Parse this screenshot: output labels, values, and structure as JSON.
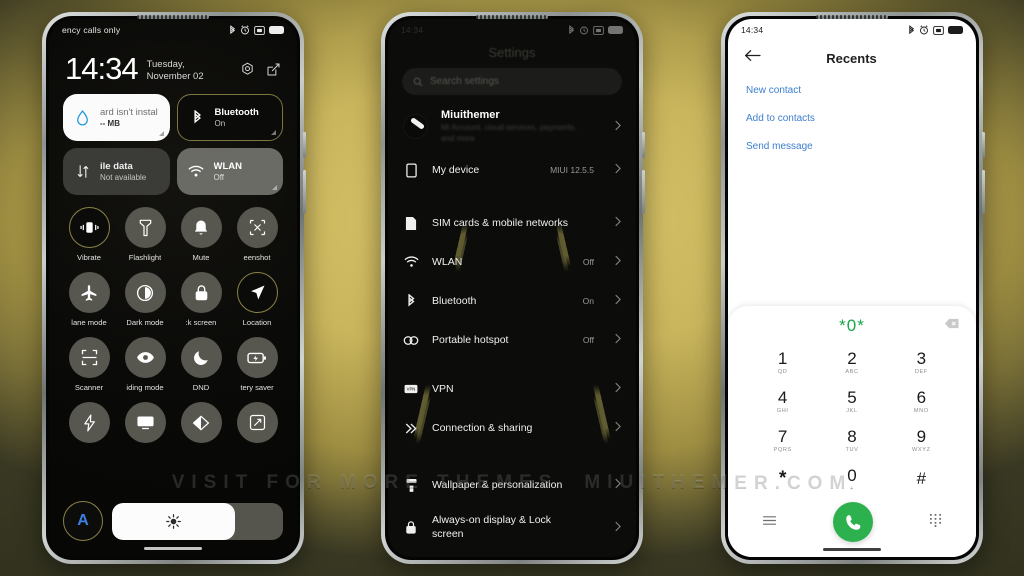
{
  "watermark": {
    "left": "VISIT FOR MORE THEMES",
    "right": "MIUITHEMER.COM"
  },
  "phone1": {
    "status": {
      "carrier": "ency calls only",
      "icons": [
        "bluetooth-icon",
        "alarm-icon",
        "screenshot-icon",
        "battery-icon"
      ]
    },
    "clock": {
      "time": "14:34",
      "date": "Tuesday, November 02"
    },
    "header_icons": [
      "settings-gear-icon",
      "edit-icon"
    ],
    "cards": [
      {
        "name": "storage",
        "title": "ard isn't instal",
        "value": "-- MB",
        "icon": "water-drop-icon",
        "style": "white"
      },
      {
        "name": "mobile-data",
        "title": "ile data",
        "value": "Not available",
        "icon": "data-transfer-icon",
        "style": "grey"
      },
      {
        "name": "bluetooth",
        "title": "Bluetooth",
        "value": "On",
        "icon": "bluetooth-icon",
        "style": "dark-highlight"
      },
      {
        "name": "wlan",
        "title": "WLAN",
        "value": "Off",
        "icon": "wifi-icon",
        "style": "light"
      }
    ],
    "tiles": [
      {
        "label": "Vibrate",
        "icon": "vibrate-icon",
        "active": true
      },
      {
        "label": "Flashlight",
        "icon": "flashlight-icon",
        "active": false
      },
      {
        "label": "Mute",
        "icon": "bell-icon",
        "active": false
      },
      {
        "label": "eenshot",
        "icon": "screenshot-scissors-icon",
        "active": false
      },
      {
        "label": "lane mode",
        "icon": "airplane-icon",
        "active": false
      },
      {
        "label": "Dark mode",
        "icon": "contrast-icon",
        "active": false
      },
      {
        "label": ":k screen",
        "icon": "lock-icon",
        "active": false
      },
      {
        "label": "Location",
        "icon": "location-arrow-icon",
        "active": true
      },
      {
        "label": "Scanner",
        "icon": "scan-frame-icon",
        "active": false
      },
      {
        "label": "iding mode",
        "icon": "eye-icon",
        "active": false
      },
      {
        "label": "DND",
        "icon": "moon-icon",
        "active": false
      },
      {
        "label": "tery saver",
        "icon": "battery-saver-icon",
        "active": false
      }
    ],
    "tiles_last_row": [
      {
        "label": "",
        "icon": "lightning-icon",
        "active": false
      },
      {
        "label": "",
        "icon": "cast-screen-icon",
        "active": false
      },
      {
        "label": "",
        "icon": "reading-contrast-icon",
        "active": false
      },
      {
        "label": "",
        "icon": "screen-rotate-icon",
        "active": false
      }
    ],
    "brightness": {
      "auto_label": "A",
      "icon": "sun-icon",
      "percent": 72
    }
  },
  "phone2": {
    "status": {
      "icons": [
        "bluetooth-icon",
        "alarm-icon",
        "screenshot-icon",
        "battery-icon"
      ]
    },
    "title": "Settings",
    "search": {
      "placeholder": "Search settings",
      "icon": "search-icon"
    },
    "account": {
      "name": "Miuithemer",
      "subtitle": "Mi Account, cloud services, payments, and more",
      "avatar": "user-avatar"
    },
    "rows": [
      {
        "label": "My device",
        "value": "MIUI 12.5.5",
        "icon": "device-icon"
      },
      {
        "label": "SIM cards & mobile networks",
        "value": "",
        "icon": "sim-card-icon"
      },
      {
        "label": "WLAN",
        "value": "Off",
        "icon": "wifi-icon"
      },
      {
        "label": "Bluetooth",
        "value": "On",
        "icon": "bluetooth-icon"
      },
      {
        "label": "Portable hotspot",
        "value": "Off",
        "icon": "hotspot-icon"
      },
      {
        "label": "VPN",
        "value": "",
        "icon": "vpn-icon"
      },
      {
        "label": "Connection & sharing",
        "value": "",
        "icon": "sharing-icon"
      },
      {
        "label": "Wallpaper & personalization",
        "value": "",
        "icon": "paint-roller-icon"
      },
      {
        "label": "Always-on display & Lock screen",
        "value": "",
        "icon": "lock-icon"
      }
    ]
  },
  "phone3": {
    "status": {
      "time": "14:34",
      "icons": [
        "bluetooth-icon",
        "alarm-icon",
        "screenshot-icon",
        "battery-icon"
      ]
    },
    "title": "Recents",
    "back_icon": "back-arrow-icon",
    "links": [
      "New contact",
      "Add to contacts",
      "Send message"
    ],
    "dialed_number": "*0*",
    "backspace_icon": "backspace-icon",
    "keys": [
      {
        "digit": "1",
        "sub": "QD"
      },
      {
        "digit": "2",
        "sub": "ABC"
      },
      {
        "digit": "3",
        "sub": "DEF"
      },
      {
        "digit": "4",
        "sub": "GHI"
      },
      {
        "digit": "5",
        "sub": "JKL"
      },
      {
        "digit": "6",
        "sub": "MNO"
      },
      {
        "digit": "7",
        "sub": "PQRS"
      },
      {
        "digit": "8",
        "sub": "TUV"
      },
      {
        "digit": "9",
        "sub": "WXYZ"
      },
      {
        "digit": "*",
        "sub": ""
      },
      {
        "digit": "0",
        "sub": "+"
      },
      {
        "digit": "#",
        "sub": ""
      }
    ],
    "footer": {
      "menu_icon": "menu-lines-icon",
      "call_icon": "phone-handset-icon",
      "keypad_icon": "keypad-dots-icon"
    },
    "accent_green": "#2db14e",
    "accent_blue": "#3c7fd0"
  }
}
